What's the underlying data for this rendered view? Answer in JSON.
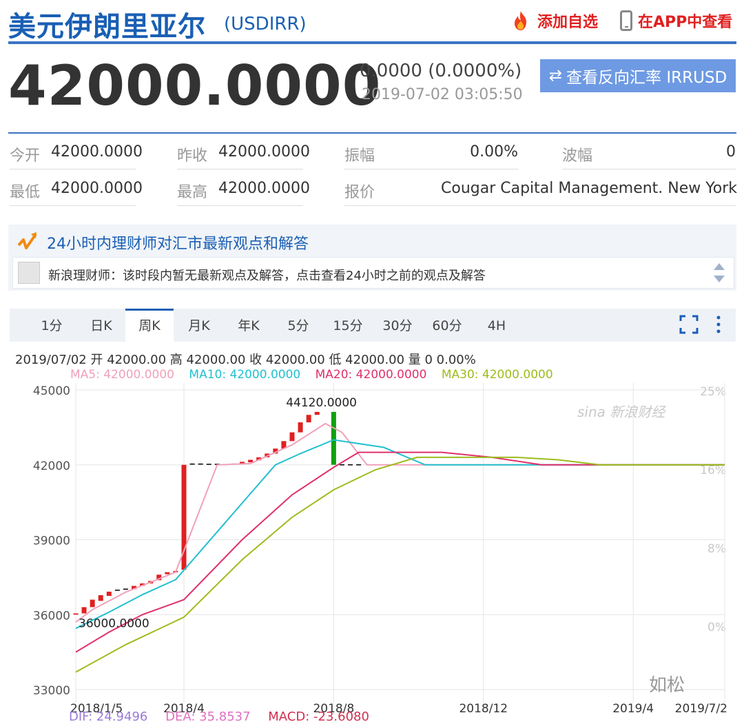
{
  "header": {
    "title": "美元伊朗里亚尔",
    "code": "(USDIRR)",
    "add_watch": "添加自选",
    "view_in_app": "在APP中查看"
  },
  "quote": {
    "price": "42000.0000",
    "change": "0.0000 (0.0000%)",
    "time": "2019-07-02 03:05:50",
    "reverse_button": "查看反向汇率 IRRUSD"
  },
  "stats": {
    "open_label": "今开",
    "open_value": "42000.0000",
    "prev_close_label": "昨收",
    "prev_close_value": "42000.0000",
    "amplitude_label": "振幅",
    "amplitude_value": "0.00%",
    "range_label": "波幅",
    "range_value": "0",
    "low_label": "最低",
    "low_value": "42000.0000",
    "high_label": "最高",
    "high_value": "42000.0000",
    "quote_label": "报价",
    "quote_value": "Cougar Capital Management. New York"
  },
  "news": {
    "title": "24小时内理财师对汇市最新观点和解答",
    "message": "新浪理财师：该时段内暂无最新观点及解答，点击查看24小时之前的观点及解答"
  },
  "tabs": [
    {
      "label": "1分",
      "active": false
    },
    {
      "label": "日K",
      "active": false
    },
    {
      "label": "周K",
      "active": true
    },
    {
      "label": "月K",
      "active": false
    },
    {
      "label": "年K",
      "active": false
    },
    {
      "label": "5分",
      "active": false
    },
    {
      "label": "15分",
      "active": false
    },
    {
      "label": "30分",
      "active": false
    },
    {
      "label": "60分",
      "active": false
    },
    {
      "label": "4H",
      "active": false
    }
  ],
  "chart_info": {
    "ohlc": "2019/07/02 开 42000.00 高 42000.00 收 42000.00 低 42000.00 量 0 0.00%",
    "ma5": "MA5: 42000.0000",
    "ma10": "MA10: 42000.0000",
    "ma20": "MA20: 42000.0000",
    "ma30": "MA30: 42000.0000",
    "watermark": "sina 新浪财经",
    "corner_watermark": "如松",
    "macd_dif": "DIF: 24.9496",
    "macd_dea": "DEA: 35.8537",
    "macd_val": "MACD: -23.6080"
  },
  "colors": {
    "ma5": "#f0a0b8",
    "ma10": "#20c0d0",
    "ma20": "#e0306a",
    "ma30": "#9cbc1c",
    "up": "#e02020",
    "down": "#10a010",
    "brand": "#1a5fb4"
  },
  "chart_data": {
    "type": "line",
    "yticks": [
      "45000",
      "42000",
      "39000",
      "36000",
      "33000"
    ],
    "ylim": [
      33000,
      45000
    ],
    "y2ticks": [
      "25%",
      "16%",
      "8%",
      "0%"
    ],
    "xticks": [
      {
        "label": "2018/1/5",
        "i": 0
      },
      {
        "label": "2018/4",
        "i": 13
      },
      {
        "label": "2018/8",
        "i": 31
      },
      {
        "label": "2018/12",
        "i": 49
      },
      {
        "label": "2019/4",
        "i": 67
      },
      {
        "label": "2019/7/2",
        "i": 78
      }
    ],
    "n": 79,
    "annotations": [
      {
        "text": "44120.0000",
        "i": 29,
        "value": 44120
      },
      {
        "text": "36000.0000",
        "i": 0,
        "value": 36000
      }
    ],
    "candles": [
      {
        "i": 0,
        "o": 36000,
        "c": 36050
      },
      {
        "i": 1,
        "o": 36050,
        "c": 36300
      },
      {
        "i": 2,
        "o": 36300,
        "c": 36600
      },
      {
        "i": 3,
        "o": 36550,
        "c": 36780
      },
      {
        "i": 4,
        "o": 36750,
        "c": 36920
      },
      {
        "i": 5,
        "o": 36940,
        "c": 36980
      },
      {
        "i": 6,
        "o": 36980,
        "c": 37020
      },
      {
        "i": 7,
        "o": 37020,
        "c": 37150
      },
      {
        "i": 8,
        "o": 37150,
        "c": 37250
      },
      {
        "i": 9,
        "o": 37250,
        "c": 37350
      },
      {
        "i": 10,
        "o": 37380,
        "c": 37600
      },
      {
        "i": 11,
        "o": 37620,
        "c": 37700
      },
      {
        "i": 12,
        "o": 37700,
        "c": 37750
      },
      {
        "i": 13,
        "o": 37800,
        "c": 42000
      },
      {
        "i": 14,
        "o": 42000,
        "c": 42030
      },
      {
        "i": 15,
        "o": 42000,
        "c": 42030
      },
      {
        "i": 16,
        "o": 42000,
        "c": 42020
      },
      {
        "i": 17,
        "o": 42000,
        "c": 42020
      },
      {
        "i": 18,
        "o": 42000,
        "c": 42010
      },
      {
        "i": 19,
        "o": 42000,
        "c": 42030
      },
      {
        "i": 20,
        "o": 42050,
        "c": 42120
      },
      {
        "i": 21,
        "o": 42100,
        "c": 42200
      },
      {
        "i": 22,
        "o": 42180,
        "c": 42300
      },
      {
        "i": 23,
        "o": 42300,
        "c": 42450
      },
      {
        "i": 24,
        "o": 42450,
        "c": 42650
      },
      {
        "i": 25,
        "o": 42650,
        "c": 42950
      },
      {
        "i": 26,
        "o": 42950,
        "c": 43300
      },
      {
        "i": 27,
        "o": 43300,
        "c": 43700
      },
      {
        "i": 28,
        "o": 43700,
        "c": 44000
      },
      {
        "i": 29,
        "o": 44000,
        "c": 44120
      },
      {
        "i": 31,
        "o": 44120,
        "c": 42000
      },
      {
        "i": 32,
        "o": 42000,
        "c": 42000
      },
      {
        "i": 33,
        "o": 42000,
        "c": 42000
      },
      {
        "i": 34,
        "o": 42000,
        "c": 42000
      }
    ],
    "series": [
      {
        "name": "MA5",
        "points": [
          [
            0,
            35700
          ],
          [
            2,
            36200
          ],
          [
            6,
            36900
          ],
          [
            12,
            37700
          ],
          [
            17,
            42000
          ],
          [
            21,
            42050
          ],
          [
            26,
            42800
          ],
          [
            30,
            43650
          ],
          [
            32,
            43300
          ],
          [
            35,
            42000
          ],
          [
            78,
            42000
          ]
        ]
      },
      {
        "name": "MA10",
        "points": [
          [
            0,
            35450
          ],
          [
            4,
            36100
          ],
          [
            8,
            36800
          ],
          [
            12,
            37400
          ],
          [
            24,
            42000
          ],
          [
            27,
            42450
          ],
          [
            31,
            43000
          ],
          [
            37,
            42700
          ],
          [
            42,
            42000
          ],
          [
            78,
            42000
          ]
        ]
      },
      {
        "name": "MA20",
        "points": [
          [
            0,
            34500
          ],
          [
            4,
            35300
          ],
          [
            8,
            36000
          ],
          [
            13,
            36600
          ],
          [
            20,
            39000
          ],
          [
            26,
            40800
          ],
          [
            31,
            41900
          ],
          [
            34,
            42500
          ],
          [
            44,
            42500
          ],
          [
            50,
            42300
          ],
          [
            56,
            42000
          ],
          [
            78,
            42000
          ]
        ]
      },
      {
        "name": "MA30",
        "points": [
          [
            0,
            33700
          ],
          [
            6,
            34800
          ],
          [
            13,
            35900
          ],
          [
            20,
            38200
          ],
          [
            26,
            39900
          ],
          [
            31,
            41000
          ],
          [
            36,
            41800
          ],
          [
            41,
            42300
          ],
          [
            53,
            42300
          ],
          [
            58,
            42200
          ],
          [
            63,
            42000
          ],
          [
            78,
            42000
          ]
        ]
      }
    ]
  }
}
